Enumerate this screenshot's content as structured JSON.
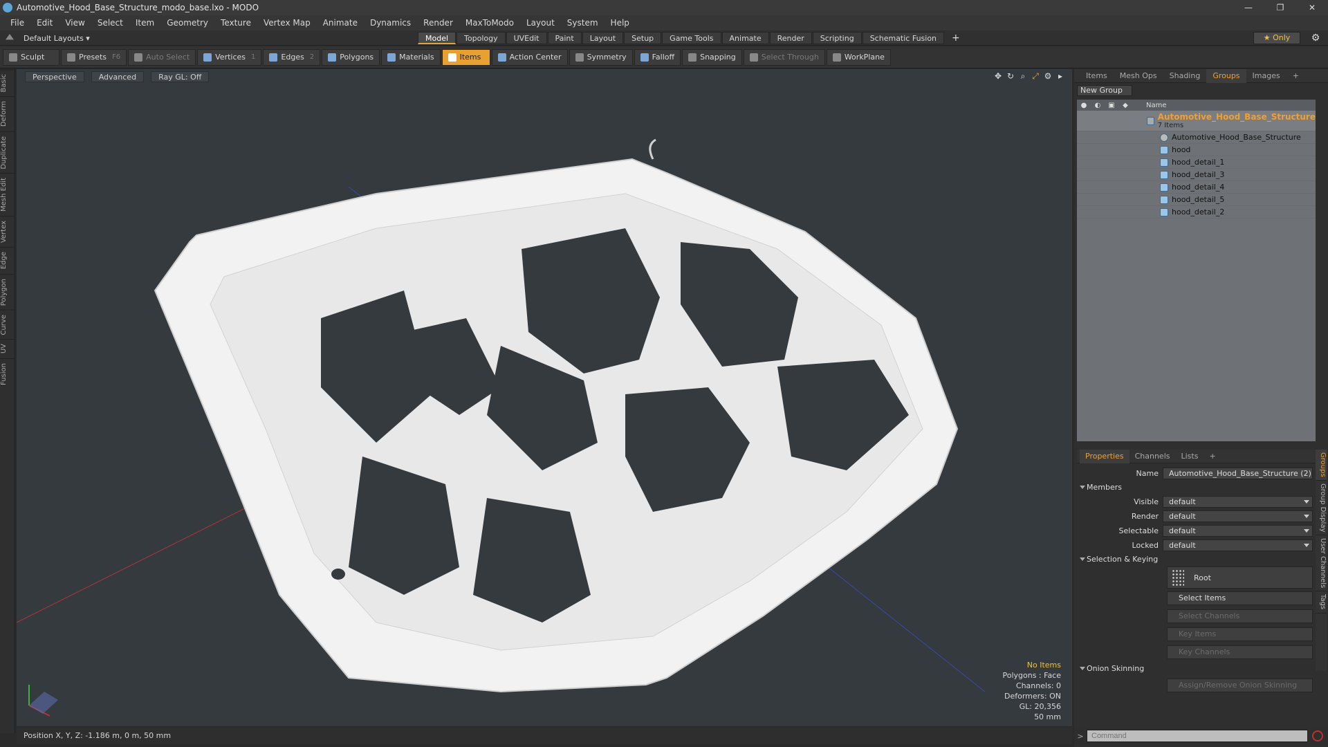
{
  "window": {
    "title": "Automotive_Hood_Base_Structure_modo_base.lxo - MODO",
    "min": "—",
    "max": "❐",
    "close": "✕"
  },
  "menu": [
    "File",
    "Edit",
    "View",
    "Select",
    "Item",
    "Geometry",
    "Texture",
    "Vertex Map",
    "Animate",
    "Dynamics",
    "Render",
    "MaxToModo",
    "Layout",
    "System",
    "Help"
  ],
  "layoutbar": {
    "layouts_label": "Default Layouts ▾",
    "tabs": [
      "Model",
      "Topology",
      "UVEdit",
      "Paint",
      "Layout",
      "Setup",
      "Game Tools",
      "Animate",
      "Render",
      "Scripting",
      "Schematic Fusion"
    ],
    "active_tab": "Model",
    "plus": "+",
    "only_label": "★  Only"
  },
  "toolbar": {
    "sculpt": "Sculpt",
    "presets": "Presets",
    "presets_key": "F6",
    "auto_select": "Auto Select",
    "vertices": "Vertices",
    "vertices_key": "1",
    "edges": "Edges",
    "edges_key": "2",
    "polygons": "Polygons",
    "materials": "Materials",
    "items": "Items",
    "action_center": "Action Center",
    "symmetry": "Symmetry",
    "falloff": "Falloff",
    "snapping": "Snapping",
    "select_through": "Select Through",
    "workplane": "WorkPlane"
  },
  "left_tabs": [
    "Basic",
    "Deform",
    "Duplicate",
    "Mesh Edit",
    "Vertex",
    "Edge",
    "Polygon",
    "Curve",
    "UV",
    "Fusion"
  ],
  "viewport": {
    "perspective": "Perspective",
    "advanced": "Advanced",
    "raygl": "Ray GL: Off",
    "info": {
      "no_items": "No Items",
      "polygons": "Polygons : Face",
      "channels": "Channels: 0",
      "deformers": "Deformers: ON",
      "gl": "GL: 20,356",
      "scale": "50 mm"
    },
    "colors": {
      "background": "#353a3f",
      "mesh": "#f2f2f2",
      "axis_x": "#b03838",
      "axis_z": "#3a4aa8"
    }
  },
  "status": {
    "position": "Position X, Y, Z:  -1.186 m, 0 m, 50 mm"
  },
  "right_panel": {
    "tabs": [
      "Items",
      "Mesh Ops",
      "Shading",
      "Groups",
      "Images"
    ],
    "active_tab": "Groups",
    "plus": "+",
    "new_group": "New Group",
    "name_col": "Name",
    "group": {
      "name": "Automotive_Hood_Base_Structure",
      "count": "7 Items"
    },
    "children": [
      "Automotive_Hood_Base_Structure",
      "hood",
      "hood_detail_1",
      "hood_detail_3",
      "hood_detail_4",
      "hood_detail_5",
      "hood_detail_2"
    ]
  },
  "properties": {
    "tabs": [
      "Properties",
      "Channels",
      "Lists"
    ],
    "active_tab": "Properties",
    "plus": "+",
    "name_label": "Name",
    "name_value": "Automotive_Hood_Base_Structure (2)",
    "members": "Members",
    "visible_label": "Visible",
    "visible_value": "default",
    "render_label": "Render",
    "render_value": "default",
    "selectable_label": "Selectable",
    "selectable_value": "default",
    "locked_label": "Locked",
    "locked_value": "default",
    "selection_keying": "Selection & Keying",
    "root": "Root",
    "select_items": "Select Items",
    "select_channels": "Select Channels",
    "key_items": "Key Items",
    "key_channels": "Key Channels",
    "onion_skinning": "Onion Skinning",
    "assign_onion": "Assign/Remove Onion Skinning"
  },
  "side_vtabs": [
    "Groups",
    "Group Display",
    "User Channels",
    "Tags"
  ],
  "command": {
    "placeholder": "Command"
  }
}
